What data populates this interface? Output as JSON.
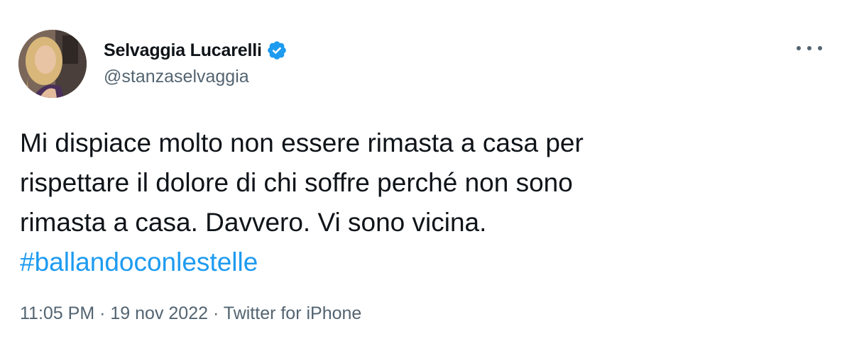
{
  "author": {
    "display_name": "Selvaggia Lucarelli",
    "handle": "@stanzaselvaggia",
    "verified": true
  },
  "tweet": {
    "lines": [
      "Mi dispiace molto non essere rimasta a casa per",
      "rispettare il dolore di chi soffre perché non sono",
      "rimasta a casa. Davvero. Vi sono vicina."
    ],
    "hashtag": "#ballandoconlestelle"
  },
  "meta": {
    "time": "11:05 PM",
    "separator": "·",
    "date": "19 nov 2022",
    "source": "Twitter for iPhone"
  },
  "colors": {
    "link": "#1d9bf0",
    "secondary": "#536471",
    "text": "#0f1419",
    "verified_badge": "#1d9bf0"
  },
  "icons": {
    "verified": "verified-badge-icon",
    "more": "more-options-icon"
  }
}
